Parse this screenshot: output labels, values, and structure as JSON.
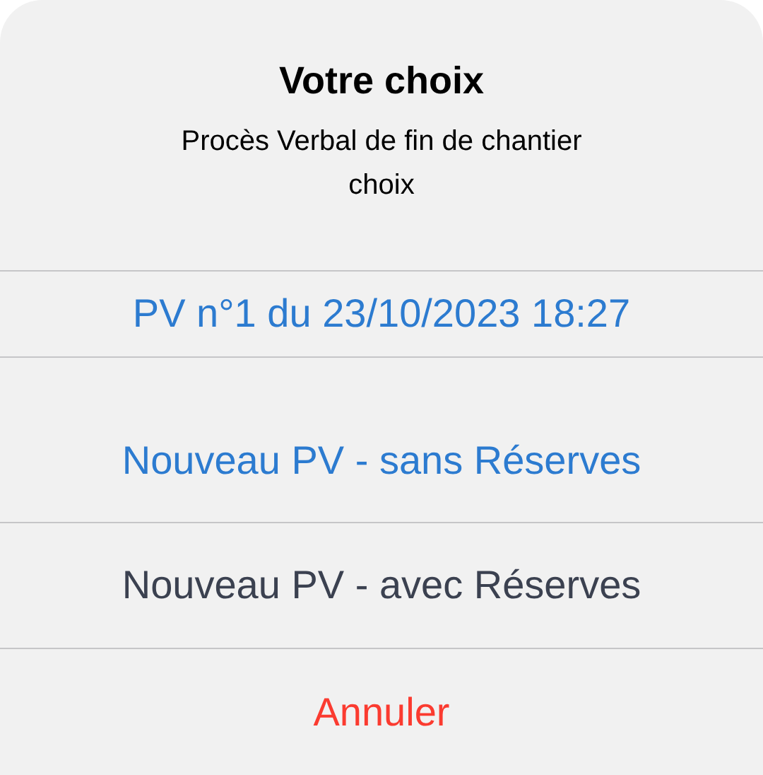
{
  "dialog": {
    "title": "Votre choix",
    "message": "Procès Verbal de fin de chantier\nchoix",
    "actions": [
      {
        "label": "PV n°1 du 23/10/2023 18:27",
        "kind": "link"
      },
      {
        "label": "Nouveau PV - sans Réserves",
        "kind": "link"
      },
      {
        "label": "Nouveau PV - avec Réserves",
        "kind": "plain"
      },
      {
        "label": "Annuler",
        "kind": "destructive"
      }
    ]
  }
}
